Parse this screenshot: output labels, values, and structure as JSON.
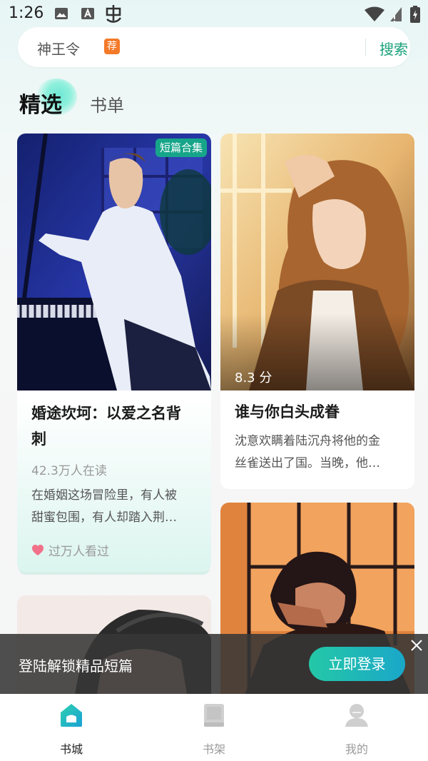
{
  "status_bar": {
    "time": "1:26"
  },
  "search": {
    "hint": "神王令",
    "badge": "荐",
    "button": "搜索"
  },
  "tabs": [
    {
      "label": "精选",
      "active": true
    },
    {
      "label": "书单",
      "active": false
    }
  ],
  "cards": [
    {
      "badge": "短篇合集",
      "title_lines": [
        "婚途坎坷：以爱之名背",
        "刺"
      ],
      "readers": "42.3万人在读",
      "desc_lines": [
        "在婚姻这场冒险里，有人被",
        "甜蜜包围，有人却踏入荆…"
      ],
      "hot": "过万人看过"
    },
    {
      "score": "8.3 分",
      "title": "谁与你白头成眷",
      "desc_lines": [
        "沈意欢瞒着陆沉舟将他的金",
        "丝雀送出了国。当晚，他…"
      ]
    }
  ],
  "login_banner": {
    "text": "登陆解锁精品短篇",
    "button": "立即登录"
  },
  "bottom_nav": [
    {
      "label": "书城",
      "active": true
    },
    {
      "label": "书架",
      "active": false
    },
    {
      "label": "我的",
      "active": false
    }
  ],
  "colors": {
    "accent": "#19a17a",
    "badge_orange": "#f47a2a",
    "nav_inactive": "#9a9a9a"
  }
}
